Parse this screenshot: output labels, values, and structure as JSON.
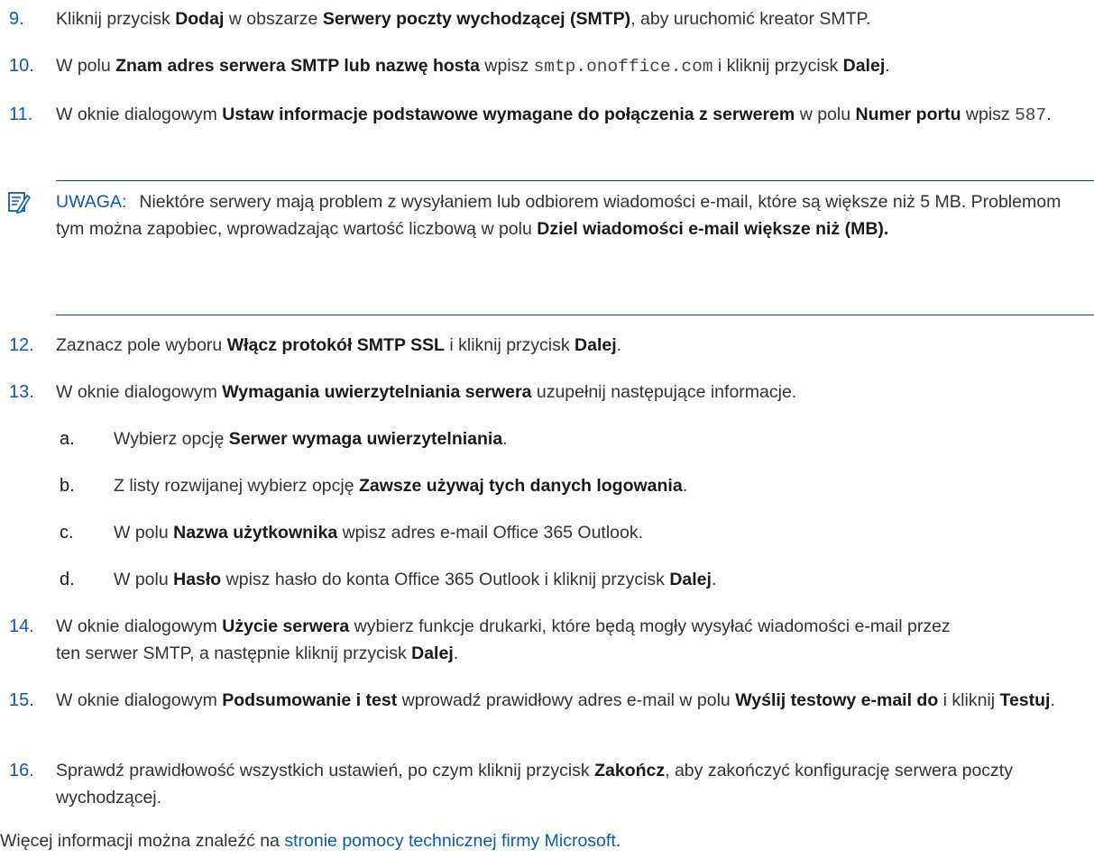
{
  "steps": {
    "s9": {
      "num": "9.",
      "t1": "Kliknij przycisk ",
      "b1": "Dodaj",
      "t2": " w obszarze ",
      "b2": "Serwery poczty wychodzącej (SMTP)",
      "t3": ", aby uruchomić kreator SMTP."
    },
    "s10": {
      "num": "10.",
      "t1": "W polu ",
      "b1": "Znam adres serwera SMTP lub nazwę hosta",
      "t2": " wpisz ",
      "code": "smtp.onoffice.com",
      "t3": " i kliknij przycisk ",
      "b2": "Dalej",
      "t4": "."
    },
    "s11": {
      "num": "11.",
      "t1": "W oknie dialogowym ",
      "b1": "Ustaw informacje podstawowe wymagane do połączenia z serwerem",
      "t2": " w polu ",
      "b2": "Numer portu",
      "t3": " wpisz ",
      "code": "587",
      "t4": "."
    },
    "s12": {
      "num": "12.",
      "t1": "Zaznacz pole wyboru ",
      "b1": "Włącz protokół SMTP SSL",
      "t2": " i kliknij przycisk ",
      "b2": "Dalej",
      "t3": "."
    },
    "s13": {
      "num": "13.",
      "t1": "W oknie dialogowym ",
      "b1": "Wymagania uwierzytelniania serwera",
      "t2": " uzupełnij następujące informacje."
    },
    "sa": {
      "num": "a.",
      "t1": "Wybierz opcję ",
      "b1": "Serwer wymaga uwierzytelniania",
      "t2": "."
    },
    "sb": {
      "num": "b.",
      "t1": "Z listy rozwijanej wybierz opcję ",
      "b1": "Zawsze używaj tych danych logowania",
      "t2": "."
    },
    "sc": {
      "num": "c.",
      "t1": "W polu ",
      "b1": "Nazwa użytkownika",
      "t2": " wpisz adres e-mail Office 365 Outlook."
    },
    "sd": {
      "num": "d.",
      "t1": "W polu ",
      "b1": "Hasło",
      "t2": " wpisz hasło do konta Office 365 Outlook i kliknij przycisk ",
      "b2": "Dalej",
      "t3": "."
    },
    "s14": {
      "num": "14.",
      "t1": "W oknie dialogowym ",
      "b1": "Użycie serwera",
      "t2": " wybierz funkcje drukarki, które będą mogły wysyłać wiadomości e-mail przez ten serwer SMTP, a następnie kliknij przycisk ",
      "b2": "Dalej",
      "t3": "."
    },
    "s15": {
      "num": "15.",
      "t1": "W oknie dialogowym ",
      "b1": "Podsumowanie i test",
      "t2": " wprowadź prawidłowy adres e-mail w polu ",
      "b2": "Wyślij testowy e-mail do",
      "t3": " i kliknij ",
      "b3": "Testuj",
      "t4": "."
    },
    "s16": {
      "num": "16.",
      "t1": "Sprawdź prawidłowość wszystkich ustawień, po czym kliknij przycisk ",
      "b1": "Zakończ",
      "t2": ", aby zakończyć konfigurację serwera poczty wychodzącej."
    }
  },
  "note": {
    "label": "UWAGA:",
    "text": "Niektóre serwery mają problem z wysyłaniem lub odbiorem wiadomości e-mail, które są większe niż 5 MB. Problemom tym można zapobiec, wprowadzając wartość liczbową w polu ",
    "bold": "Dziel wiadomości e-mail większe niż (MB).",
    "icon": "note-icon"
  },
  "footer": {
    "text": "Więcej informacji można znaleźć na ",
    "link": "stronie pomocy technicznej firmy Microsoft",
    "end": "."
  },
  "colors": {
    "accent": "#0b5cab",
    "rule": "#1f3c6e"
  }
}
